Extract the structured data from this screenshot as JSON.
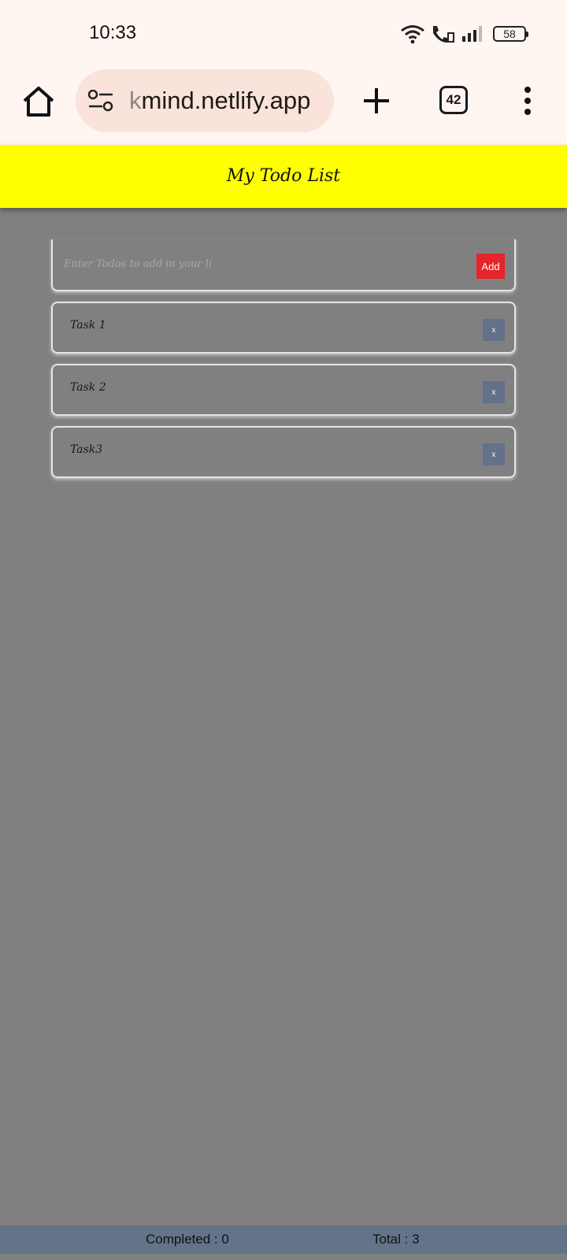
{
  "status_bar": {
    "time": "10:33",
    "battery_level": "58",
    "icons": [
      "wifi-icon",
      "call-icon",
      "signal-icon",
      "battery-icon"
    ]
  },
  "browser": {
    "url_faded": "k",
    "url_main": "mind.netlify.app",
    "tab_count": "42",
    "icons": [
      "home-icon",
      "site-settings-icon",
      "plus-icon",
      "tabs-icon",
      "more-vert-icon"
    ]
  },
  "app": {
    "title": "My Todo List",
    "input": {
      "placeholder": "Enter Todos to add in your li",
      "value": ""
    },
    "add_label": "Add",
    "todos": [
      {
        "text": "Task 1",
        "remove_label": "x"
      },
      {
        "text": "Task 2",
        "remove_label": "x"
      },
      {
        "text": "Task3",
        "remove_label": "x"
      }
    ],
    "footer": {
      "completed": "Completed : 0",
      "total": "Total : 3"
    }
  },
  "colors": {
    "header": "#ffff00",
    "background": "#808080",
    "add_button": "#e8232a",
    "remove_button": "#637189",
    "footer": "#647389",
    "browser_chrome": "#fff6f2",
    "url_pill": "#fae3da"
  }
}
